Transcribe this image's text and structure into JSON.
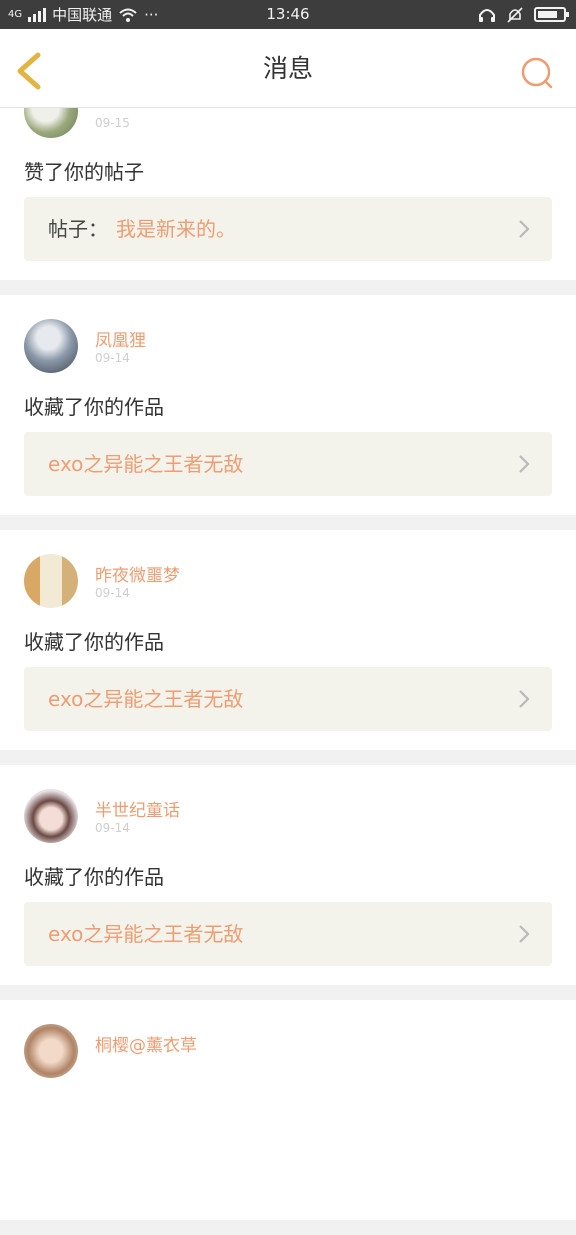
{
  "status_bar": {
    "network": "4G",
    "carrier": "中国联通",
    "more": "···",
    "time": "13:46",
    "battery_level": 0.8
  },
  "header": {
    "title": "消息"
  },
  "notifications": [
    {
      "username": "",
      "date": "09-15",
      "action": "赞了你的帖子",
      "work_prefix": "帖子：",
      "work_title": "我是新来的。"
    },
    {
      "username": "凤凰狸",
      "date": "09-14",
      "action": "收藏了你的作品",
      "work_prefix": "",
      "work_title": "exo之异能之王者无敌"
    },
    {
      "username": "昨夜微噩梦",
      "date": "09-14",
      "action": "收藏了你的作品",
      "work_prefix": "",
      "work_title": "exo之异能之王者无敌"
    },
    {
      "username": "半世纪童话",
      "date": "09-14",
      "action": "收藏了你的作品",
      "work_prefix": "",
      "work_title": "exo之异能之王者无敌"
    },
    {
      "username": "桐樱@薰衣草",
      "date": "",
      "action": "",
      "work_prefix": "",
      "work_title": ""
    }
  ],
  "colors": {
    "accent": "#ee9d72",
    "back_arrow": "#e3b441",
    "card_link_bg": "#f3f3ec",
    "status_bar_bg": "#3d3d3d"
  },
  "icons": {
    "back": "chevron-left-icon",
    "search": "search-icon",
    "row_chevron": "chevron-right-icon"
  }
}
